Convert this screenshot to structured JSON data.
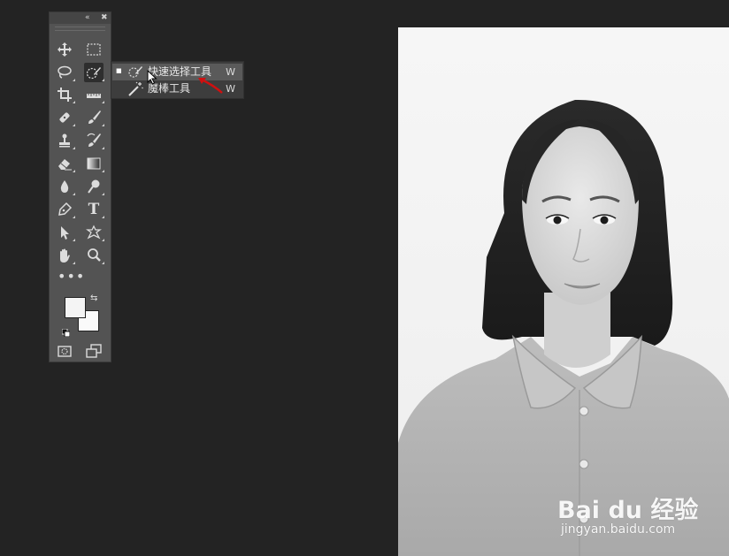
{
  "toolbar": {
    "collapse_glyph": "«",
    "close_glyph": "✖",
    "more_glyph": "•••",
    "tools": [
      {
        "name": "move-tool"
      },
      {
        "name": "rectangular-marquee-tool"
      },
      {
        "name": "lasso-tool"
      },
      {
        "name": "quick-selection-tool"
      },
      {
        "name": "crop-tool"
      },
      {
        "name": "ruler-tool"
      },
      {
        "name": "healing-brush-tool"
      },
      {
        "name": "brush-tool"
      },
      {
        "name": "clone-stamp-tool"
      },
      {
        "name": "history-brush-tool"
      },
      {
        "name": "eraser-tool"
      },
      {
        "name": "gradient-tool"
      },
      {
        "name": "blur-tool"
      },
      {
        "name": "dodge-tool"
      },
      {
        "name": "pen-tool"
      },
      {
        "name": "type-tool"
      },
      {
        "name": "path-selection-tool"
      },
      {
        "name": "custom-shape-tool"
      },
      {
        "name": "hand-tool"
      },
      {
        "name": "zoom-tool"
      }
    ],
    "type_glyph": "T",
    "swap_glyph": "⇆",
    "foreground_color": "#f4f4f4",
    "background_color": "#fafafa"
  },
  "flyout": {
    "items": [
      {
        "label": "快速选择工具",
        "shortcut": "W",
        "selected": true,
        "icon": "quick-selection-icon"
      },
      {
        "label": "魔棒工具",
        "shortcut": "W",
        "selected": false,
        "icon": "magic-wand-icon"
      }
    ],
    "selected_bullet": "■"
  },
  "watermark": {
    "brand": "Bai du 经验",
    "url": "jingyan.baidu.com"
  },
  "colors": {
    "workspace_bg": "#232323",
    "toolbar_bg": "#535353",
    "flyout_bg": "#3d3d3d",
    "annotation_arrow": "#d01010"
  }
}
